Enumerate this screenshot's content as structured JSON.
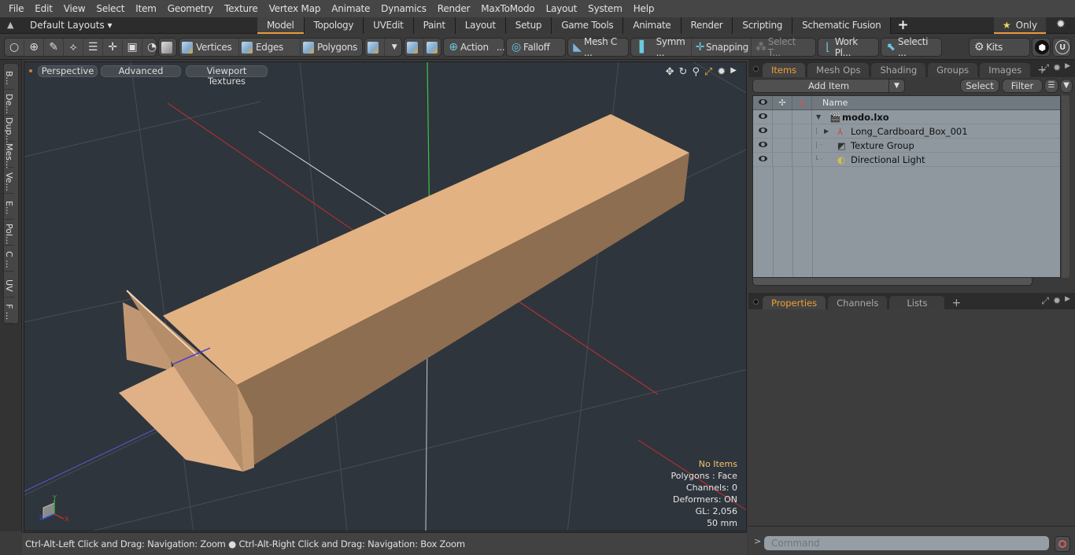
{
  "menu": [
    "File",
    "Edit",
    "View",
    "Select",
    "Item",
    "Geometry",
    "Texture",
    "Vertex Map",
    "Animate",
    "Dynamics",
    "Render",
    "MaxToModo",
    "Layout",
    "System",
    "Help"
  ],
  "layoutbar": {
    "layouts_label": "Default Layouts ▾",
    "tabs": [
      "Model",
      "Topology",
      "UVEdit",
      "Paint",
      "Layout",
      "Setup",
      "Game Tools",
      "Animate",
      "Render",
      "Scripting",
      "Schematic Fusion"
    ],
    "active_tab": "Model",
    "only_label": "Only"
  },
  "toolbar": {
    "vertices": "Vertices",
    "edges": "Edges",
    "polygons": "Polygons",
    "action": "Action",
    "action_more": "...",
    "falloff": "Falloff",
    "mesh_c": "Mesh C ...",
    "symm": "Symm ...",
    "snapping": "Snapping",
    "select_t": "Select T...",
    "work_pl": "Work Pl...",
    "selecti": "Selecti ...",
    "kits": "Kits"
  },
  "left_tabs": [
    "B...",
    "De...",
    "Dup...",
    "Mes...",
    "Ve...",
    "E...",
    "Pol...",
    "C ...",
    "UV",
    "F ..."
  ],
  "viewport": {
    "perspective": "Perspective",
    "advanced": "Advanced",
    "viewport_textures": "Viewport Textures",
    "info": {
      "selection": "No Items",
      "polygons": "Polygons : Face",
      "channels": "Channels: 0",
      "deformers": "Deformers: ON",
      "gl": "GL: 2,056",
      "scale": "50 mm"
    },
    "axis": {
      "x": "X",
      "y": "Y",
      "z": "Z"
    },
    "colors": {
      "background": "#2f353c",
      "box_top": "#e3b283",
      "box_side": "#8e6e50",
      "box_front": "#b99272"
    }
  },
  "status": {
    "hint_left": "Ctrl-Alt-Left Click and Drag: Navigation: Zoom",
    "hint_right": "Ctrl-Alt-Right Click and Drag: Navigation: Box Zoom"
  },
  "items_panel": {
    "tabs": [
      "Items",
      "Mesh Ops",
      "Shading",
      "Groups",
      "Images"
    ],
    "active_tab": "Items",
    "add_item": "Add Item",
    "select": "Select",
    "filter": "Filter",
    "column_name": "Name",
    "rows": [
      {
        "name": "modo.lxo",
        "depth": 0,
        "expander": "▼",
        "bold": true,
        "icon": "scene-icon"
      },
      {
        "name": "Long_Cardboard_Box_001",
        "depth": 1,
        "expander": "▶",
        "bold": false,
        "icon": "mesh-locator-icon"
      },
      {
        "name": "Texture Group",
        "depth": 1,
        "expander": "",
        "bold": false,
        "icon": "texture-group-icon"
      },
      {
        "name": "Directional Light",
        "depth": 1,
        "expander": "",
        "bold": false,
        "icon": "light-icon"
      }
    ]
  },
  "properties_panel": {
    "tabs": [
      "Properties",
      "Channels",
      "Lists"
    ],
    "active_tab": "Properties"
  },
  "command": {
    "prompt": ">",
    "placeholder": "Command"
  },
  "accent_color": "#e89a3c"
}
